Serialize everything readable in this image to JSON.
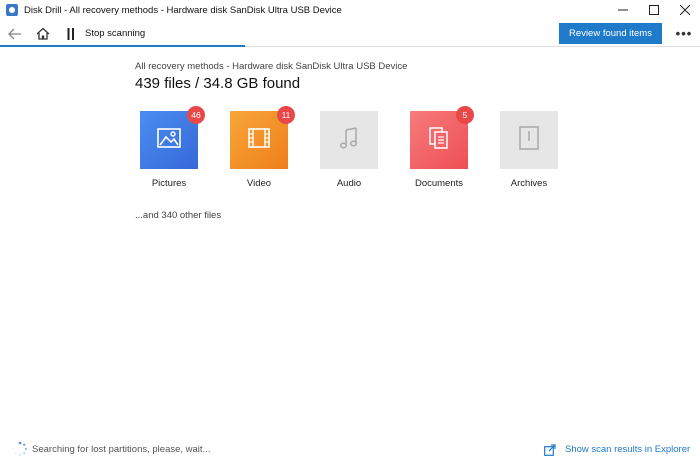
{
  "window": {
    "title": "Disk Drill - All recovery methods - Hardware disk SanDisk Ultra USB Device",
    "controls": [
      "minimize-icon",
      "maximize-icon",
      "close-icon"
    ]
  },
  "toolbar": {
    "stop_label": "Stop scanning",
    "review_label": "Review found items",
    "more_label": "•••",
    "progress": 0.35,
    "accent_color": "#1f7ac9"
  },
  "main": {
    "subtitle": "All recovery methods - Hardware disk SanDisk Ultra USB Device",
    "headline": "439 files / 34.8 GB found",
    "categories": [
      {
        "label": "Pictures",
        "badge": "46",
        "icon": "image-icon",
        "color": "#3e7ce4"
      },
      {
        "label": "Video",
        "badge": "11",
        "icon": "film-icon",
        "color": "#f39229"
      },
      {
        "label": "Audio",
        "badge": "",
        "icon": "music-note-icon",
        "color": "#e6e6e6"
      },
      {
        "label": "Documents",
        "badge": "5",
        "icon": "documents-icon",
        "color": "#f06468"
      },
      {
        "label": "Archives",
        "badge": "",
        "icon": "archive-icon",
        "color": "#e6e6e6"
      }
    ],
    "other_files": "...and 340 other files"
  },
  "status": {
    "searching_text": "Searching for lost partitions, please, wait...",
    "explorer_link": "Show scan results in Explorer"
  }
}
